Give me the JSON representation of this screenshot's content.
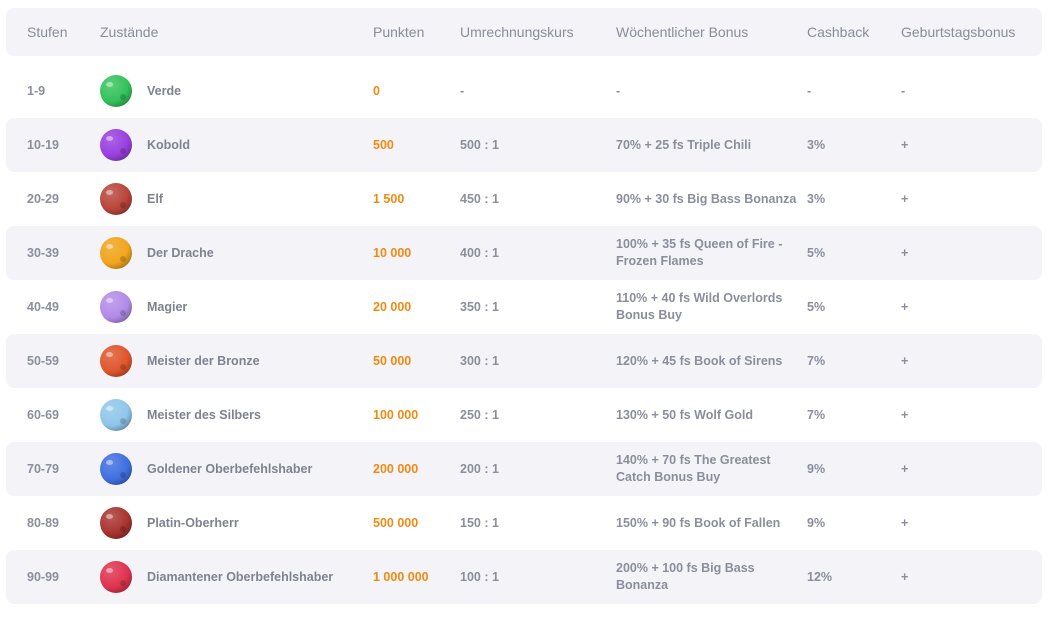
{
  "header": {
    "stufen": "Stufen",
    "zustaende": "Zustände",
    "punkten": "Punkten",
    "kurs": "Umrechnungskurs",
    "bonus": "Wöchentlicher Bonus",
    "cashback": "Cashback",
    "geburtstag": "Geburtstagsbonus"
  },
  "rows": [
    {
      "stufe": "1-9",
      "name": "Verde",
      "icon": "green-planet-icon",
      "color": "#33c25a",
      "points": "0",
      "kurs": "-",
      "bonus": "-",
      "cashback": "-",
      "geburtstag": "-"
    },
    {
      "stufe": "10-19",
      "name": "Kobold",
      "icon": "purple-planet-icon",
      "color": "#9a3fe0",
      "points": "500",
      "kurs": "500 : 1",
      "bonus": "70% + 25 fs Triple Chili",
      "cashback": "3%",
      "geburtstag": "+"
    },
    {
      "stufe": "20-29",
      "name": "Elf",
      "icon": "rocky-red-planet-icon",
      "color": "#b8443a",
      "points": "1 500",
      "kurs": "450 : 1",
      "bonus": "90% + 30 fs Big Bass Bonanza",
      "cashback": "3%",
      "geburtstag": "+"
    },
    {
      "stufe": "30-39",
      "name": "Der Drache",
      "icon": "golden-planet-icon",
      "color": "#f2a51c",
      "points": "10 000",
      "kurs": "400 : 1",
      "bonus": "100% + 35 fs Queen of Fire - Frozen Flames",
      "cashback": "5%",
      "geburtstag": "+"
    },
    {
      "stufe": "40-49",
      "name": "Magier",
      "icon": "lilac-moon-icon",
      "color": "#b28be8",
      "points": "20 000",
      "kurs": "350 : 1",
      "bonus": "110% + 40 fs Wild Overlords Bonus Buy",
      "cashback": "5%",
      "geburtstag": "+"
    },
    {
      "stufe": "50-59",
      "name": "Meister der Bronze",
      "icon": "bronze-planet-icon",
      "color": "#e0562b",
      "points": "50 000",
      "kurs": "300 : 1",
      "bonus": "120% + 45 fs Book of Sirens",
      "cashback": "7%",
      "geburtstag": "+"
    },
    {
      "stufe": "60-69",
      "name": "Meister des Silbers",
      "icon": "silver-planet-icon",
      "color": "#8fc6ea",
      "points": "100 000",
      "kurs": "250 : 1",
      "bonus": "130% + 50 fs Wolf Gold",
      "cashback": "7%",
      "geburtstag": "+"
    },
    {
      "stufe": "70-79",
      "name": "Goldener Oberbefehlshaber",
      "icon": "blue-planet-icon",
      "color": "#3f6fe0",
      "points": "200 000",
      "kurs": "200 : 1",
      "bonus": "140% + 70 fs The Greatest Catch Bonus Buy",
      "cashback": "9%",
      "geburtstag": "+"
    },
    {
      "stufe": "80-89",
      "name": "Platin-Oberherr",
      "icon": "crimson-planet-icon",
      "color": "#a8332f",
      "points": "500 000",
      "kurs": "150 : 1",
      "bonus": "150% + 90 fs Book of Fallen",
      "cashback": "9%",
      "geburtstag": "+"
    },
    {
      "stufe": "90-99",
      "name": "Diamantener Oberbefehlshaber",
      "icon": "magenta-planet-icon",
      "color": "#e0334f",
      "points": "1 000 000",
      "kurs": "100 : 1",
      "bonus": "200% + 100 fs Big Bass Bonanza",
      "cashback": "12%",
      "geburtstag": "+"
    }
  ]
}
